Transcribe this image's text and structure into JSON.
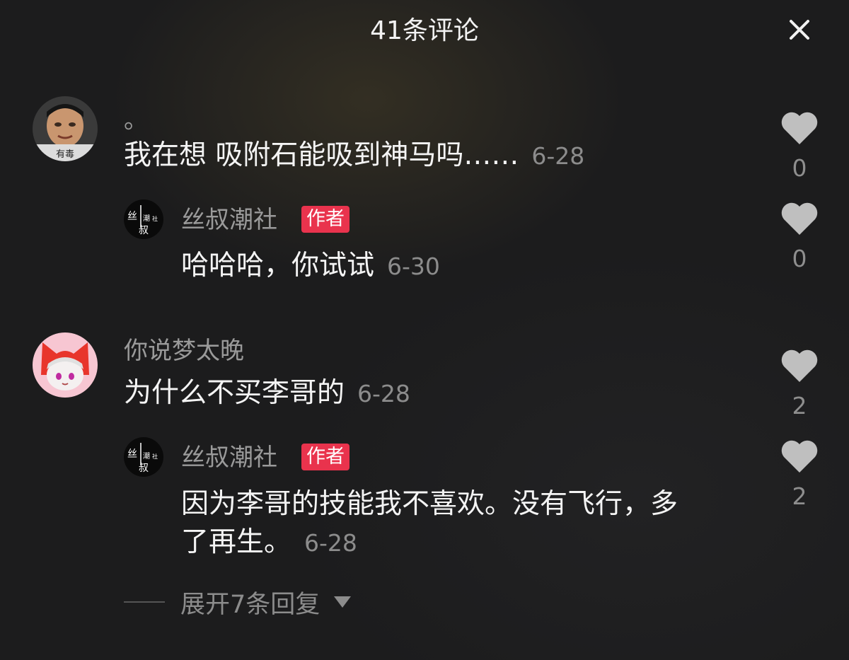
{
  "header": {
    "title": "41条评论",
    "close_icon": "close-icon"
  },
  "comments": [
    {
      "username": "。",
      "text": "我在想 吸附石能吸到神马吗……",
      "date": "6-28",
      "likes": "0",
      "avatar_label": "有毒",
      "reply": {
        "username": "丝叔潮社",
        "badge": "作者",
        "text": "哈哈哈，你试试",
        "date": "6-30",
        "likes": "0"
      }
    },
    {
      "username": "你说梦太晚",
      "text": "为什么不买李哥的",
      "date": "6-28",
      "likes": "2",
      "reply": {
        "username": "丝叔潮社",
        "badge": "作者",
        "text_line1": "因为李哥的技能我不喜欢。没有飞行，多",
        "text_line2": "了再生。",
        "date": "6-28",
        "likes": "2"
      }
    }
  ],
  "author_avatar_logo": {
    "chars": [
      "丝",
      "潮",
      "社",
      "叔"
    ]
  },
  "expand": {
    "label": "展开7条回复"
  },
  "colors": {
    "background": "#1c1c1d",
    "badge": "#e9334d",
    "muted_text": "#8c8c8c",
    "heart": "#bfbfbf"
  }
}
